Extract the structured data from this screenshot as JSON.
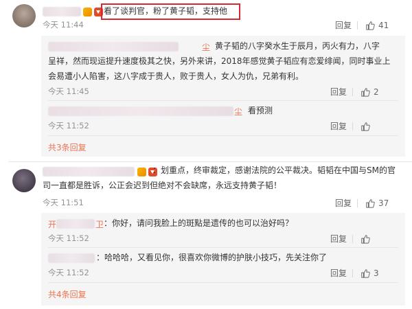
{
  "comments": [
    {
      "name_suffix": "",
      "text": "看了谈判官，粉了黄子韬，支持他",
      "time": "今天 11:44",
      "reply_label": "回复",
      "likes": "41",
      "replies": [
        {
          "name_suffix": "尘",
          "text_lines": [
            "黄子韬的八字癸水生于辰月，丙火有力，八字",
            "呈祥，然而现运提升速度极其之快，另外来讲，2018年感觉黄子韬应有恋爱绯闻，同时事业上",
            "会易遭小人陷害，这八字成于贵人，败于贵人，女人为仇，兄弟有利。"
          ],
          "time": "今天 11:45",
          "reply_label": "回复",
          "likes": "2"
        },
        {
          "name_suffix": "尘",
          "text_lines": [
            "看预测"
          ],
          "time": "今天 11:52",
          "reply_label": "回复",
          "likes": ""
        }
      ],
      "more_label": "共3条回复"
    },
    {
      "name_suffix": "",
      "text_lines": [
        "：划重点，终审裁定，感谢法院的公平裁决。韬韬在中国与SM的官",
        "司一直都是胜诉，公正会迟到但绝对不会缺席，永远支持黄子韬！"
      ],
      "time": "今天 11:51",
      "reply_label": "回复",
      "likes": "37",
      "replies": [
        {
          "name_prefix": "开",
          "name_suffix": "卫",
          "text_lines": [
            "：你好，请问我脸上的斑點是遗传的也可以治好吗？"
          ],
          "time": "今天 11:52",
          "reply_label": "回复",
          "likes": ""
        },
        {
          "name_suffix": "",
          "text_lines": [
            "：哈哈哈，又看见你，很喜欢你微博的护肤小技巧，先关注你了"
          ],
          "time": "今天 11:52",
          "reply_label": "回复",
          "likes": "3"
        }
      ],
      "more_label": "共4条回复"
    }
  ],
  "colors": {
    "accent": "#eb7350",
    "highlight_border": "#d8282d",
    "sub_bg": "#f5f5f5",
    "time": "#939393"
  },
  "icons": {
    "like": "thumbs-up-icon",
    "badge_1": "vip-badge-icon",
    "badge_2": "weibo-badge-icon"
  }
}
